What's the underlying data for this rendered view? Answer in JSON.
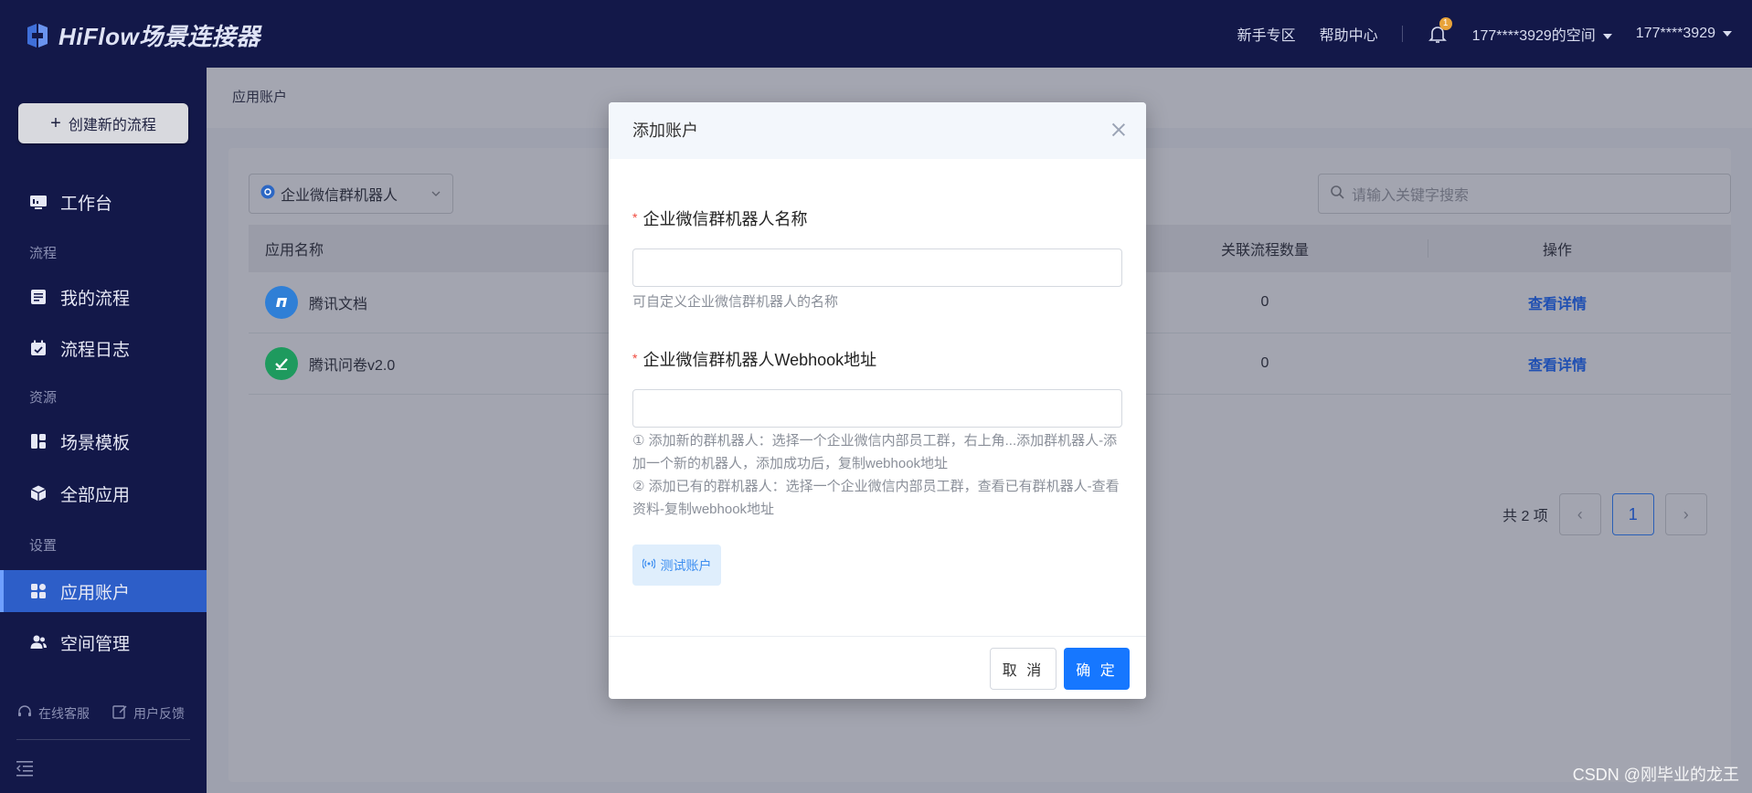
{
  "header": {
    "logo_text": "HiFlow场景连接器",
    "links": {
      "newbie": "新手专区",
      "help": "帮助中心"
    },
    "notification_count": "1",
    "workspace": "177****3929的空间",
    "user": "177****3929"
  },
  "sidebar": {
    "create_button": "创建新的流程",
    "items": {
      "workbench": "工作台",
      "section_flow": "流程",
      "my_flows": "我的流程",
      "flow_log": "流程日志",
      "section_resource": "资源",
      "templates": "场景模板",
      "all_apps": "全部应用",
      "section_settings": "设置",
      "app_accounts": "应用账户",
      "space_mgmt": "空间管理"
    },
    "bottom": {
      "support": "在线客服",
      "feedback": "用户反馈"
    }
  },
  "page": {
    "breadcrumb": "应用账户",
    "app_filter": "企业微信群机器人",
    "search_placeholder": "请输入关键字搜索",
    "table": {
      "columns": {
        "name": "应用名称",
        "count": "关联流程数量",
        "op": "操作"
      },
      "rows": [
        {
          "name": "腾讯文档",
          "count": "0",
          "op": "查看详情",
          "logo_color": "#2f7fd6"
        },
        {
          "name": "腾讯问卷v2.0",
          "count": "0",
          "op": "查看详情",
          "logo_color": "#1e9a5e"
        }
      ]
    },
    "pager": {
      "total": "共 2 项",
      "current": "1",
      "prev": "‹",
      "next": "›"
    }
  },
  "modal": {
    "title": "添加账户",
    "field1": {
      "label": "企业微信群机器人名称",
      "value": "",
      "help": "可自定义企业微信群机器人的名称"
    },
    "field2": {
      "label": "企业微信群机器人Webhook地址",
      "value": "",
      "help1": "① 添加新的群机器人：选择一个企业微信内部员工群，右上角...添加群机器人-添加一个新的机器人，添加成功后，复制webhook地址",
      "help2": "② 添加已有的群机器人：选择一个企业微信内部员工群，查看已有群机器人-查看资料-复制webhook地址"
    },
    "test_button": "测试账户",
    "cancel": "取 消",
    "ok": "确 定"
  },
  "watermark": "CSDN @刚毕业的龙王",
  "colors": {
    "primary": "#1677ff",
    "nav_bg": "#131849",
    "active": "#2d5ec8"
  }
}
